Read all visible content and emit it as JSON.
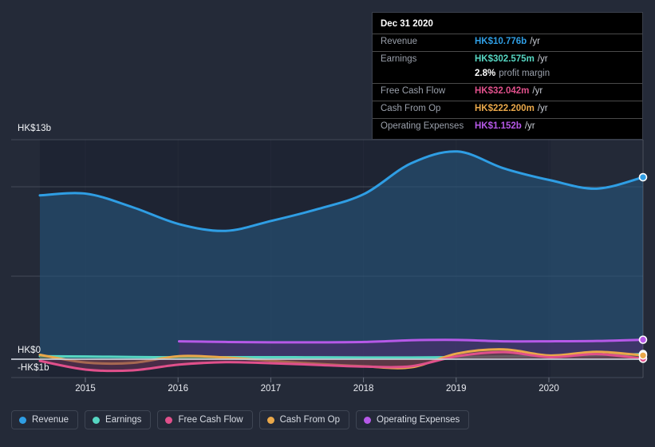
{
  "chart_data": {
    "type": "area",
    "title": "",
    "xlabel": "",
    "ylabel": "",
    "currency": "HK$",
    "grid": true,
    "legend_position": "bottom",
    "ylim": [
      -1,
      13
    ],
    "y_ticks": [
      {
        "label": "HK$13b",
        "value": 13
      },
      {
        "label": "HK$0",
        "value": 0
      },
      {
        "label": "-HK$1b",
        "value": -1
      }
    ],
    "x_ticks": [
      "2015",
      "2016",
      "2017",
      "2018",
      "2019",
      "2020"
    ],
    "x": [
      "2014.5",
      "2015",
      "2015.5",
      "2016",
      "2016.5",
      "2017",
      "2017.5",
      "2018",
      "2018.5",
      "2019",
      "2019.5",
      "2020",
      "2020.5",
      "2020.95"
    ],
    "series": [
      {
        "name": "Revenue",
        "color": "#2f9ee4",
        "fill": "#27557a",
        "values": [
          9.7,
          9.8,
          9.0,
          8.0,
          7.6,
          8.2,
          8.9,
          9.8,
          11.6,
          12.3,
          11.3,
          10.6,
          10.1,
          10.776
        ]
      },
      {
        "name": "Earnings",
        "color": "#56d6c2",
        "fill": "#2b6f73",
        "values": [
          0.18,
          0.16,
          0.13,
          0.11,
          0.12,
          0.12,
          0.11,
          0.1,
          0.1,
          0.12,
          0.16,
          0.2,
          0.24,
          0.302575
        ]
      },
      {
        "name": "Free Cash Flow",
        "color": "#e0508b",
        "fill": "#6d3358",
        "values": [
          -0.1,
          -0.62,
          -0.66,
          -0.32,
          -0.18,
          -0.24,
          -0.34,
          -0.44,
          -0.42,
          0.18,
          0.42,
          0.12,
          0.3,
          0.032042
        ]
      },
      {
        "name": "Cash From Op",
        "color": "#eaa84a",
        "fill": "#6b5531",
        "values": [
          0.26,
          -0.2,
          -0.22,
          0.18,
          0.1,
          -0.1,
          -0.28,
          -0.42,
          -0.48,
          0.34,
          0.58,
          0.22,
          0.44,
          0.2222
        ]
      },
      {
        "name": "Operating Expenses",
        "color": "#b659e8",
        "fill": "#46306b",
        "values": [
          null,
          null,
          null,
          1.06,
          1.02,
          1.0,
          1.0,
          1.02,
          1.12,
          1.14,
          1.06,
          1.06,
          1.08,
          1.152
        ]
      }
    ]
  },
  "axis": {
    "top_label": "HK$13b",
    "zero_label": "HK$0",
    "negative_label": "-HK$1b"
  },
  "tooltip": {
    "date": "Dec 31 2020",
    "rows": [
      {
        "label": "Revenue",
        "value": "HK$10.776b",
        "unit": "/yr",
        "color": "#2f9ee4"
      },
      {
        "label": "Earnings",
        "value": "HK$302.575m",
        "unit": "/yr",
        "color": "#56d6c2"
      },
      {
        "label": "Free Cash Flow",
        "value": "HK$32.042m",
        "unit": "/yr",
        "color": "#e0508b"
      },
      {
        "label": "Cash From Op",
        "value": "HK$222.200m",
        "unit": "/yr",
        "color": "#eaa84a"
      },
      {
        "label": "Operating Expenses",
        "value": "HK$1.152b",
        "unit": "/yr",
        "color": "#b659e8"
      }
    ],
    "margin_value": "2.8%",
    "margin_text": "profit margin"
  },
  "legend": {
    "items": [
      {
        "label": "Revenue",
        "color": "#2f9ee4"
      },
      {
        "label": "Earnings",
        "color": "#56d6c2"
      },
      {
        "label": "Free Cash Flow",
        "color": "#e0508b"
      },
      {
        "label": "Cash From Op",
        "color": "#eaa84a"
      },
      {
        "label": "Operating Expenses",
        "color": "#b659e8"
      }
    ]
  }
}
